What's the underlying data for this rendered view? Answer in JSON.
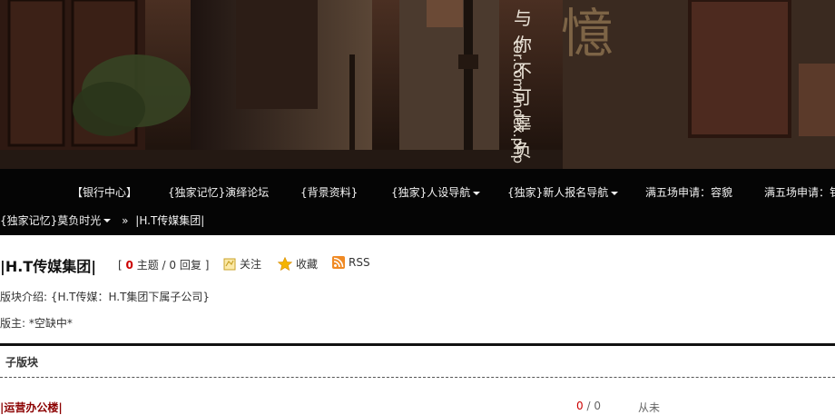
{
  "banner": {
    "slogan": "与你不可辜负",
    "url_fragment": "tor.com/index.php",
    "big_char": "憶"
  },
  "nav": {
    "items": [
      {
        "label": "【银行中心】",
        "dropdown": false
      },
      {
        "label": "{独家记忆}演绎论坛",
        "dropdown": false
      },
      {
        "label": "{背景资料}",
        "dropdown": false
      },
      {
        "label": "{独家}人设导航",
        "dropdown": true
      },
      {
        "label": "{独家}新人报名导航",
        "dropdown": true
      },
      {
        "label": "满五场申请：容貌",
        "dropdown": false
      },
      {
        "label": "满五场申请：钅",
        "dropdown": false
      }
    ],
    "breadcrumb": {
      "parent": "{独家记忆}莫负时光",
      "separator": "»",
      "current": "|H.T传媒集团|"
    }
  },
  "forum": {
    "title": "|H.T传媒集团|",
    "stats": {
      "open": "[",
      "topics": "0",
      "topics_label": "主题",
      "slash": "/",
      "replies": "0",
      "replies_label": "回复",
      "close": "]"
    },
    "actions": {
      "follow": "关注",
      "favorite": "收藏",
      "rss": "RSS"
    },
    "intro_label": "版块介绍:",
    "intro_text": "{H.T传媒：H.T集团下属子公司}",
    "moderator_label": "版主:",
    "moderator_value": "*空缺中*"
  },
  "subforums": {
    "heading": "子版块",
    "rows": [
      {
        "name": "|运营办公楼|",
        "topics": "0",
        "posts": "0",
        "last": "从未"
      }
    ]
  },
  "colors": {
    "nav_bg": "#050505",
    "board_link": "#8b0000",
    "count_highlight": "#cc0000"
  }
}
